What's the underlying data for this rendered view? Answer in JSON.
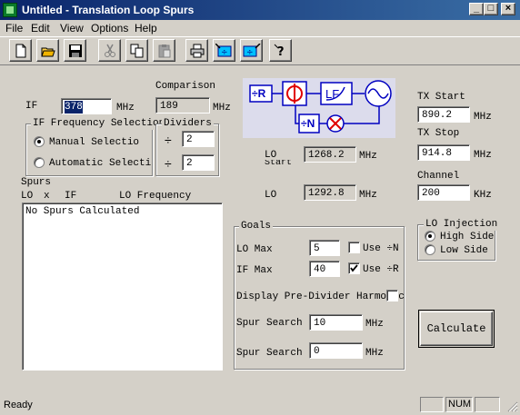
{
  "window": {
    "title": "Untitled - Translation Loop Spurs"
  },
  "menu": [
    "File",
    "Edit",
    "View",
    "Options",
    "Help"
  ],
  "toolbar": {
    "icons": [
      "new-file-icon",
      "open-folder-icon",
      "save-icon",
      "cut-icon",
      "copy-icon",
      "paste-icon",
      "print-icon",
      "divider-display-icon",
      "divider-select-icon",
      "help-icon"
    ]
  },
  "if_section": {
    "if_label": "IF",
    "if_value": "378",
    "if_unit": "MHz",
    "comparison_label": "Comparison",
    "comparison_value": "189",
    "comparison_unit": "MHz"
  },
  "if_freq_selection": {
    "legend": "IF Frequency Selection",
    "manual_label": "Manual Selectio",
    "automatic_label": "Automatic Selecti",
    "selected": "manual"
  },
  "dividers": {
    "legend": "Dividers",
    "symbol": "÷",
    "div1": "2",
    "div2": "2"
  },
  "diagram": {
    "r_label": "÷R",
    "phase_label": "Φ",
    "lf_label": "LF",
    "n_label": "÷N",
    "bg_color": "#dcdcec"
  },
  "lo_fields": {
    "lo1_label": "LO",
    "lo1_sub": "Start",
    "lo1_value": "1268.2",
    "lo1_unit": "MHz",
    "lo2_label": "LO",
    "lo2_value": "1292.8",
    "lo2_unit": "MHz"
  },
  "tx": {
    "start_label": "TX  Start",
    "start_value": "890.2",
    "start_unit": "MHz",
    "stop_label": "TX Stop",
    "stop_value": "914.8",
    "stop_unit": "MHz",
    "channel_label": "Channel",
    "channel_value": "200",
    "channel_unit": "KHz"
  },
  "spurs": {
    "title": "Spurs",
    "col_lo": "LO",
    "col_x": "x",
    "col_if": "IF",
    "col_lofreq": "LO Frequency",
    "content": "No Spurs Calculated"
  },
  "goals": {
    "legend": "Goals",
    "lo_max_label": "LO Max",
    "lo_max_value": "5",
    "use_n_label": "Use ÷N",
    "use_n_checked": false,
    "if_max_label": "IF   Max",
    "if_max_value": "40",
    "use_r_label": "Use ÷R",
    "use_r_checked": true,
    "pre_divider_label": "Display Pre-Divider Harmonic",
    "pre_divider_checked": false,
    "spur_search1_label": "Spur Search",
    "spur_search1_value": "10",
    "spur_search1_unit": "MHz",
    "spur_search2_label": "Spur Search",
    "spur_search2_value": "0",
    "spur_search2_unit": "MHz"
  },
  "lo_injection": {
    "legend": "LO Injection",
    "high_label": "High Side",
    "low_label": "Low Side",
    "selected": "high"
  },
  "calculate_label": "Calculate",
  "status": {
    "text": "Ready",
    "num": "NUM"
  }
}
